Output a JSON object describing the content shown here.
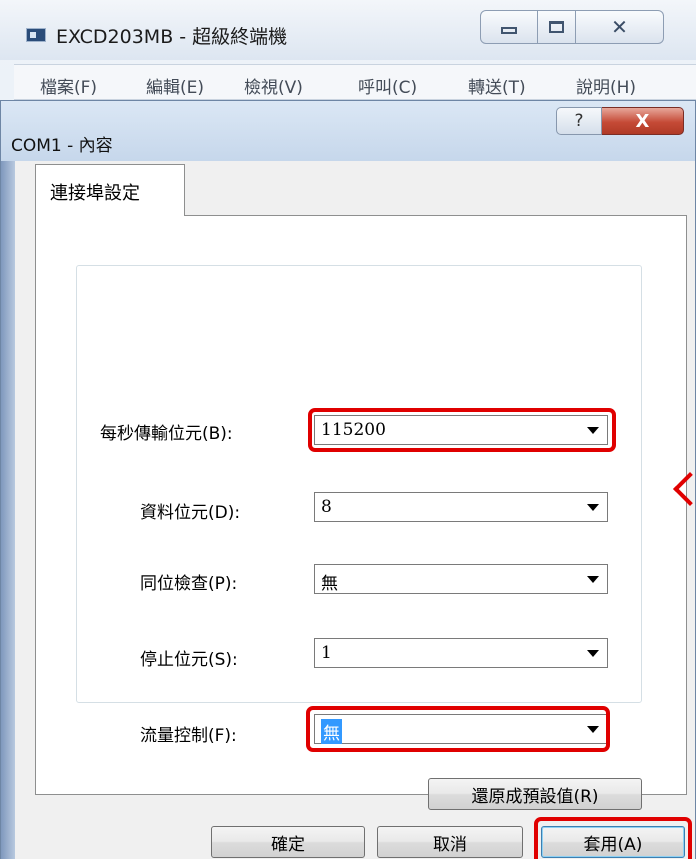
{
  "background_window": {
    "title": "EXCD203MB - 超級終端機",
    "controls": {
      "minimize": "minimize-icon",
      "maximize": "maximize-icon",
      "close": "✕"
    },
    "menu": [
      {
        "label": "檔案(F)"
      },
      {
        "label": "編輯(E)"
      },
      {
        "label": "檢視(V)"
      },
      {
        "label": "呼叫(C)"
      },
      {
        "label": "轉送(T)"
      },
      {
        "label": "說明(H)"
      }
    ]
  },
  "dialog": {
    "title": "COM1 - 內容",
    "help_label": "?",
    "close_label": "X",
    "tab_label": "連接埠設定",
    "fields": [
      {
        "label": "每秒傳輸位元(B):",
        "value": "115200",
        "highlighted": true
      },
      {
        "label": "資料位元(D):",
        "value": "8",
        "highlighted": false
      },
      {
        "label": "同位檢查(P):",
        "value": "無",
        "highlighted": false
      },
      {
        "label": "停止位元(S):",
        "value": "1",
        "highlighted": false
      },
      {
        "label": "流量控制(F):",
        "value": "無",
        "highlighted": true
      }
    ],
    "restore_button": "還原成預設值(R)",
    "buttons": {
      "ok": "確定",
      "cancel": "取消",
      "apply": "套用(A)"
    }
  },
  "colors": {
    "highlight_red": "#e00000",
    "selection_blue": "#3399ff"
  }
}
